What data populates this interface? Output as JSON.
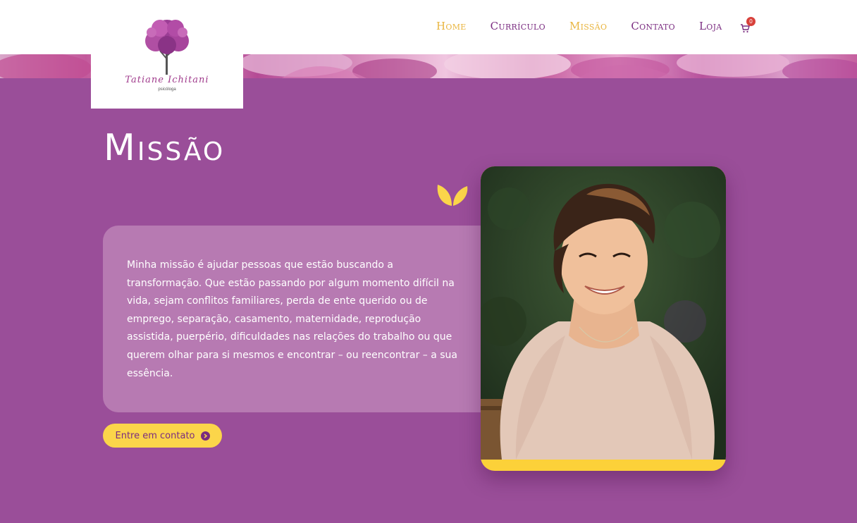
{
  "header": {
    "nav": [
      {
        "label": "Home",
        "active": true
      },
      {
        "label": "Currículo",
        "active": false
      },
      {
        "label": "Missão",
        "active": true
      },
      {
        "label": "Contato",
        "active": false
      },
      {
        "label": "Loja",
        "active": false
      }
    ],
    "cart": {
      "icon": "cart-icon",
      "count": "0"
    }
  },
  "logo": {
    "name": "Tatiane Ichitani",
    "subtitle": "psicóloga"
  },
  "main": {
    "title": "Missão",
    "description": "Minha missão é ajudar pessoas que estão buscando a transformação. Que estão passando por algum momento difícil na vida, sejam conflitos familiares, perda de ente querido ou de emprego, separação, casamento, maternidade, reprodução assistida, puerpério, dificuldades nas relações do trabalho ou que querem olhar para si mesmos e encontrar – ou reencontrar – a sua essência.",
    "cta_label": "Entre em contato",
    "cta_icon": "chevron-circle-right-icon"
  },
  "colors": {
    "background": "#9a4e99",
    "accent": "#fbd54a",
    "nav_text": "#7a2c80",
    "nav_active": "#e9b53f",
    "card": "#b77ab2"
  }
}
